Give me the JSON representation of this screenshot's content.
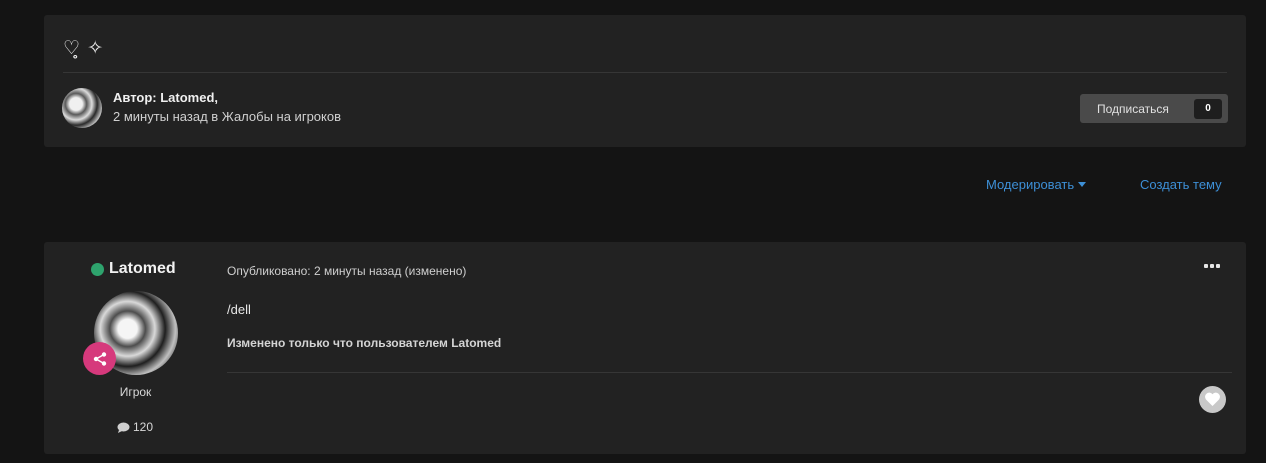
{
  "topic": {
    "title": "♡̥ ✧",
    "author_label": "Автор: Latomed,",
    "meta": "2 минуты назад в Жалобы на игроков",
    "subscribe_label": "Подписаться",
    "subscribe_count": "0"
  },
  "actions": {
    "moderate": "Модерировать",
    "create_topic": "Создать тему"
  },
  "post": {
    "username": "Latomed",
    "group": "Игрок",
    "post_count": "120",
    "meta": "Опубликовано: 2 минуты назад (изменено)",
    "body": "/dell",
    "edited_note": "Изменено только что пользователем Latomed"
  },
  "colors": {
    "accent_link": "#3d8fd6",
    "online": "#2ea36d",
    "rank_badge": "#d6397c",
    "panel": "#222222",
    "background": "#141414"
  },
  "icons": [
    "heart-sparkle-title",
    "share-icon",
    "comment-icon",
    "more-dots-icon",
    "heart-icon"
  ]
}
